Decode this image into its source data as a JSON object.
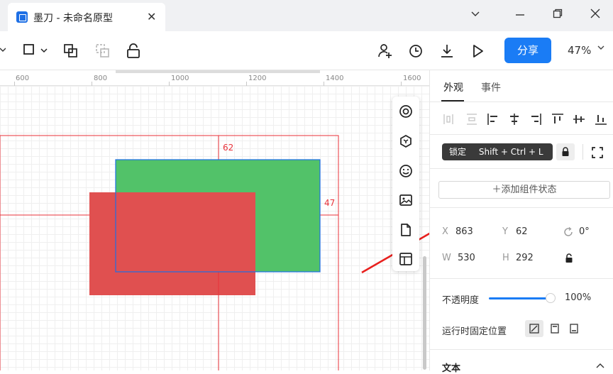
{
  "window": {
    "tab_title": "墨刀 - 未命名原型",
    "tab_close": "✕",
    "minimize_icon": "chevron-down-icon",
    "maximize_icon": "restore-icon",
    "close_icon": "close-icon"
  },
  "toolbar": {
    "share_label": "分享",
    "zoom_label": "47%",
    "icons": [
      "frame-dropdown-icon",
      "group-icon",
      "ungroup-icon",
      "unlock-icon",
      "add-user-icon",
      "history-icon",
      "download-icon",
      "play-icon"
    ]
  },
  "ruler": {
    "labels": [
      "600",
      "800",
      "1000",
      "1200",
      "1400",
      "1600"
    ]
  },
  "canvas": {
    "guide_top_label": "62",
    "guide_right_label": "47",
    "colors": {
      "green_rect": "#52c269",
      "red_rect": "#e05050",
      "guide": "#e8323a",
      "selection": "#1d6fe5"
    }
  },
  "float_panel": {
    "icons": [
      "target-icon",
      "component-icon",
      "emoji-icon",
      "image-icon",
      "document-icon",
      "template-icon"
    ]
  },
  "right_panel": {
    "tab_appearance": "外观",
    "tab_events": "事件",
    "tooltip_lock": "锁定",
    "tooltip_shortcut": "Shift + Ctrl + L",
    "add_state_label": "添加组件状态",
    "x_label": "X",
    "x_value": "863",
    "y_label": "Y",
    "y_value": "62",
    "rotation_value": "0°",
    "w_label": "W",
    "w_value": "530",
    "h_label": "H",
    "h_value": "292",
    "opacity_label": "不透明度",
    "opacity_value": "100%",
    "opacity_level": 1.0,
    "fix_position_label": "运行时固定位置",
    "text_section_label": "文本",
    "accent_color": "#1a7cf5"
  }
}
